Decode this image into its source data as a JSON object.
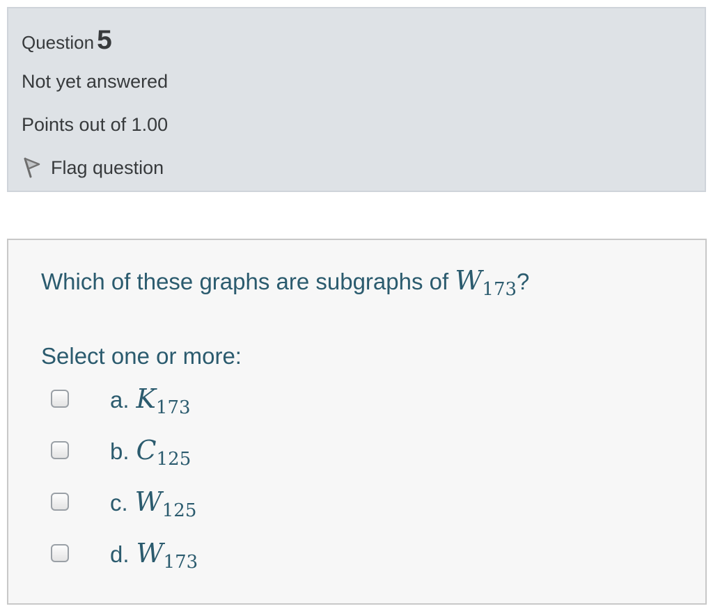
{
  "info": {
    "question_label": "Question",
    "question_number": "5",
    "state": "Not yet answered",
    "grade": "Points out of 1.00",
    "flag_label": "Flag question",
    "flag_icon": "flag-outline-icon"
  },
  "question": {
    "text_before": "Which of these graphs are subgraphs of ",
    "math_symbol": "W",
    "math_subscript": "173",
    "text_after": "?"
  },
  "answer": {
    "prompt": "Select one or more:",
    "options": [
      {
        "letter": "a.",
        "symbol": "K",
        "subscript": "173",
        "checked": false
      },
      {
        "letter": "b.",
        "symbol": "C",
        "subscript": "125",
        "checked": false
      },
      {
        "letter": "c.",
        "symbol": "W",
        "subscript": "125",
        "checked": false
      },
      {
        "letter": "d.",
        "symbol": "W",
        "subscript": "173",
        "checked": false
      }
    ]
  },
  "colors": {
    "info_background": "#dee2e6",
    "question_text": "#2b5b6e",
    "formulation_background": "#f7f7f7"
  }
}
